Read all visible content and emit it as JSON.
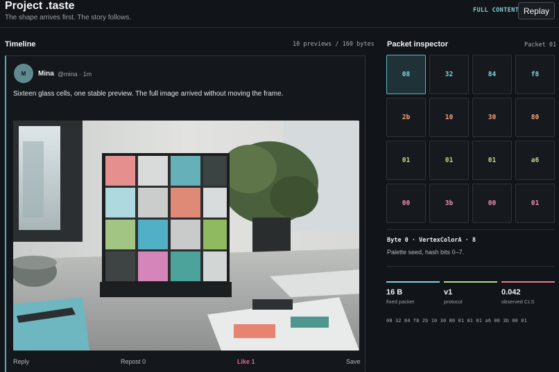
{
  "header": {
    "title": "Project .taste",
    "subtitle": "The shape arrives first. The story follows.",
    "full_content_label": "FULL CONTENT",
    "replay_label": "Replay"
  },
  "timeline": {
    "title": "Timeline",
    "meta": "10 previews / 160 bytes",
    "post": {
      "avatar_initial": "M",
      "author": "Mina",
      "handle": "@mina · 1m",
      "text": "Sixteen glass cells, one stable preview. The full image arrived without moving the frame.",
      "image_alt": "Sixteen colored glass cubes in a 4x4 frame on a desk by a window",
      "actions": {
        "reply": "Reply",
        "repost": "Repost 0",
        "like": "Like 1",
        "save": "Save"
      }
    }
  },
  "inspector": {
    "title": "Packet inspector",
    "packet_label": "Packet 01",
    "cells": [
      {
        "value": "08",
        "color": "#7fd3dc",
        "selected": true
      },
      {
        "value": "32",
        "color": "#7fd3dc"
      },
      {
        "value": "84",
        "color": "#7fd3dc"
      },
      {
        "value": "f8",
        "color": "#7fd3dc"
      },
      {
        "value": "2b",
        "color": "#f2a081"
      },
      {
        "value": "10",
        "color": "#f2a081"
      },
      {
        "value": "30",
        "color": "#f2a081"
      },
      {
        "value": "80",
        "color": "#f2a081"
      },
      {
        "value": "01",
        "color": "#b7d98c"
      },
      {
        "value": "01",
        "color": "#b7d98c"
      },
      {
        "value": "01",
        "color": "#b7d98c"
      },
      {
        "value": "a6",
        "color": "#b7d98c"
      },
      {
        "value": "00",
        "color": "#f08fb5"
      },
      {
        "value": "3b",
        "color": "#f08fb5"
      },
      {
        "value": "00",
        "color": "#f08fb5"
      },
      {
        "value": "01",
        "color": "#f08fb5"
      }
    ],
    "byte_title": "Byte 0 · VertexColorA · 8",
    "byte_desc": "Palette seed, hash bits 0–7.",
    "stats": [
      {
        "value": "16 B",
        "label": "fixed packet",
        "color": "#7fd3dc"
      },
      {
        "value": "v1",
        "label": "protocol",
        "color": "#b7d98c"
      },
      {
        "value": "0.042",
        "label": "observed CLS",
        "color": "#f0788a"
      }
    ],
    "bytes_line": "08 32 84 f8 2b 10 30 80 01 01 01 a6 00 3b 00 01"
  }
}
